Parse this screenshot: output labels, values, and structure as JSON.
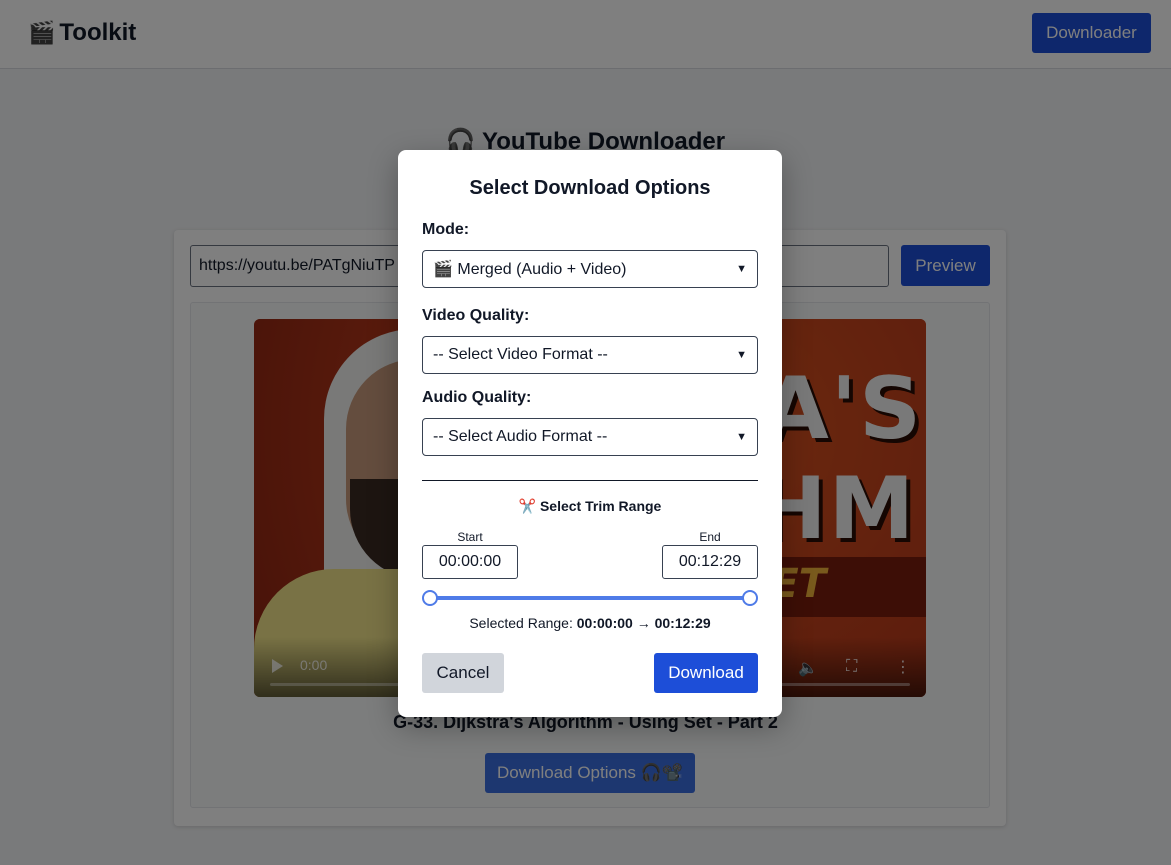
{
  "header": {
    "brand_emoji": "🎬",
    "brand_name": "Toolkit",
    "nav_button_label": "Downloader"
  },
  "page": {
    "title_emoji": "🎧",
    "title": "YouTube Downloader",
    "url_value": "https://youtu.be/PATgNiuTP",
    "preview_label": "Preview",
    "video_time": "0:00",
    "thumbnail_text": "RA'S\nTHM",
    "thumbnail_band_text": "ET",
    "video_title": "G-33. Dijkstra's Algorithm - Using Set - Part 2",
    "download_options_label": "Download Options 🎧📽️"
  },
  "modal": {
    "title": "Select Download Options",
    "mode_label": "Mode:",
    "mode_value": "🎬 Merged (Audio + Video)",
    "video_quality_label": "Video Quality:",
    "video_quality_value": "-- Select Video Format --",
    "audio_quality_label": "Audio Quality:",
    "audio_quality_value": "-- Select Audio Format --",
    "trim_title": "✂️ Select Trim Range",
    "start_label": "Start",
    "start_value": "00:00:00",
    "end_label": "End",
    "end_value": "00:12:29",
    "range_prefix": "Selected Range:",
    "range_start": "00:00:00",
    "range_arrow": "→",
    "range_end": "00:12:29",
    "trim_start_fraction": 0.0,
    "trim_end_fraction": 1.0,
    "cancel_label": "Cancel",
    "download_label": "Download"
  },
  "colors": {
    "primary": "#1d4ed8",
    "slider": "#4f7be8",
    "cancel_bg": "#d1d5db",
    "overlay": "rgba(0,0,0,0.5)"
  }
}
